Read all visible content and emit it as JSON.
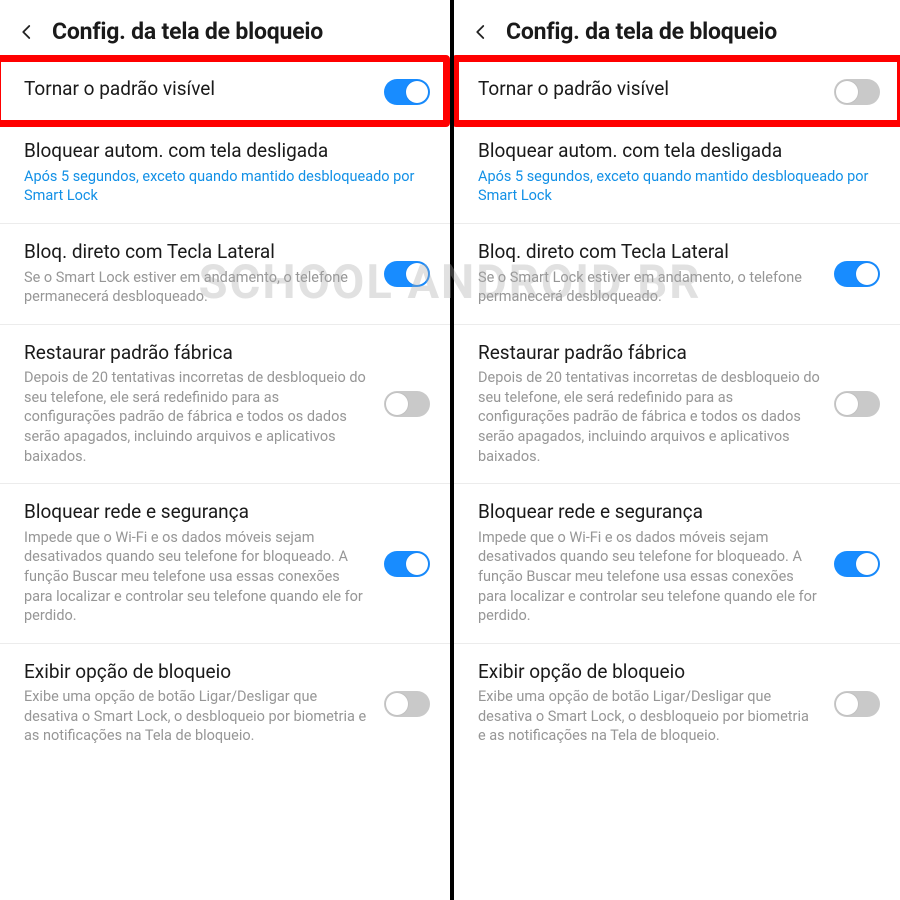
{
  "watermark": "SCHOOL ANDROID BR",
  "left": {
    "title": "Config. da tela de bloqueio",
    "items": [
      {
        "title": "Tornar o padrão visível",
        "sub": "",
        "link": false,
        "toggle": "on",
        "highlight": true
      },
      {
        "title": "Bloquear autom. com tela desligada",
        "sub": "Após 5 segundos, exceto quando mantido desbloqueado por Smart Lock",
        "link": true,
        "toggle": null
      },
      {
        "title": "Bloq. direto com Tecla Lateral",
        "sub": "Se o Smart Lock estiver em andamento, o telefone permanecerá desbloqueado.",
        "link": false,
        "toggle": "on"
      },
      {
        "title": "Restaurar padrão fábrica",
        "sub": "Depois de 20 tentativas incorretas de desbloqueio do seu telefone, ele será redefinido para as configurações padrão de fábrica e todos os dados serão apagados, incluindo arquivos e aplicativos baixados.",
        "link": false,
        "toggle": "off"
      },
      {
        "title": "Bloquear rede e segurança",
        "sub": "Impede que o Wi-Fi e os dados móveis sejam desativados quando seu telefone for bloqueado. A função Buscar meu telefone usa essas conexões para localizar e controlar seu telefone quando ele for perdido.",
        "link": false,
        "toggle": "on"
      },
      {
        "title": "Exibir opção de bloqueio",
        "sub": "Exibe uma opção de botão Ligar/Desligar que desativa o Smart Lock, o desbloqueio por biometria e as notificações na Tela de bloqueio.",
        "link": false,
        "toggle": "off"
      }
    ]
  },
  "right": {
    "title": "Config. da tela de bloqueio",
    "items": [
      {
        "title": "Tornar o padrão visível",
        "sub": "",
        "link": false,
        "toggle": "off",
        "highlight": true
      },
      {
        "title": "Bloquear autom. com tela desligada",
        "sub": "Após 5 segundos, exceto quando mantido desbloqueado por Smart Lock",
        "link": true,
        "toggle": null
      },
      {
        "title": "Bloq. direto com Tecla Lateral",
        "sub": "Se o Smart Lock estiver em andamento, o telefone permanecerá desbloqueado.",
        "link": false,
        "toggle": "on"
      },
      {
        "title": "Restaurar padrão fábrica",
        "sub": "Depois de 20 tentativas incorretas de desbloqueio do seu telefone, ele será redefinido para as configurações padrão de fábrica e todos os dados serão apagados, incluindo arquivos e aplicativos baixados.",
        "link": false,
        "toggle": "off"
      },
      {
        "title": "Bloquear rede e segurança",
        "sub": "Impede que o Wi-Fi e os dados móveis sejam desativados quando seu telefone for bloqueado. A função Buscar meu telefone usa essas conexões para localizar e controlar seu telefone quando ele for perdido.",
        "link": false,
        "toggle": "on"
      },
      {
        "title": "Exibir opção de bloqueio",
        "sub": "Exibe uma opção de botão Ligar/Desligar que desativa o Smart Lock, o desbloqueio por biometria e as notificações na Tela de bloqueio.",
        "link": false,
        "toggle": "off"
      }
    ]
  }
}
